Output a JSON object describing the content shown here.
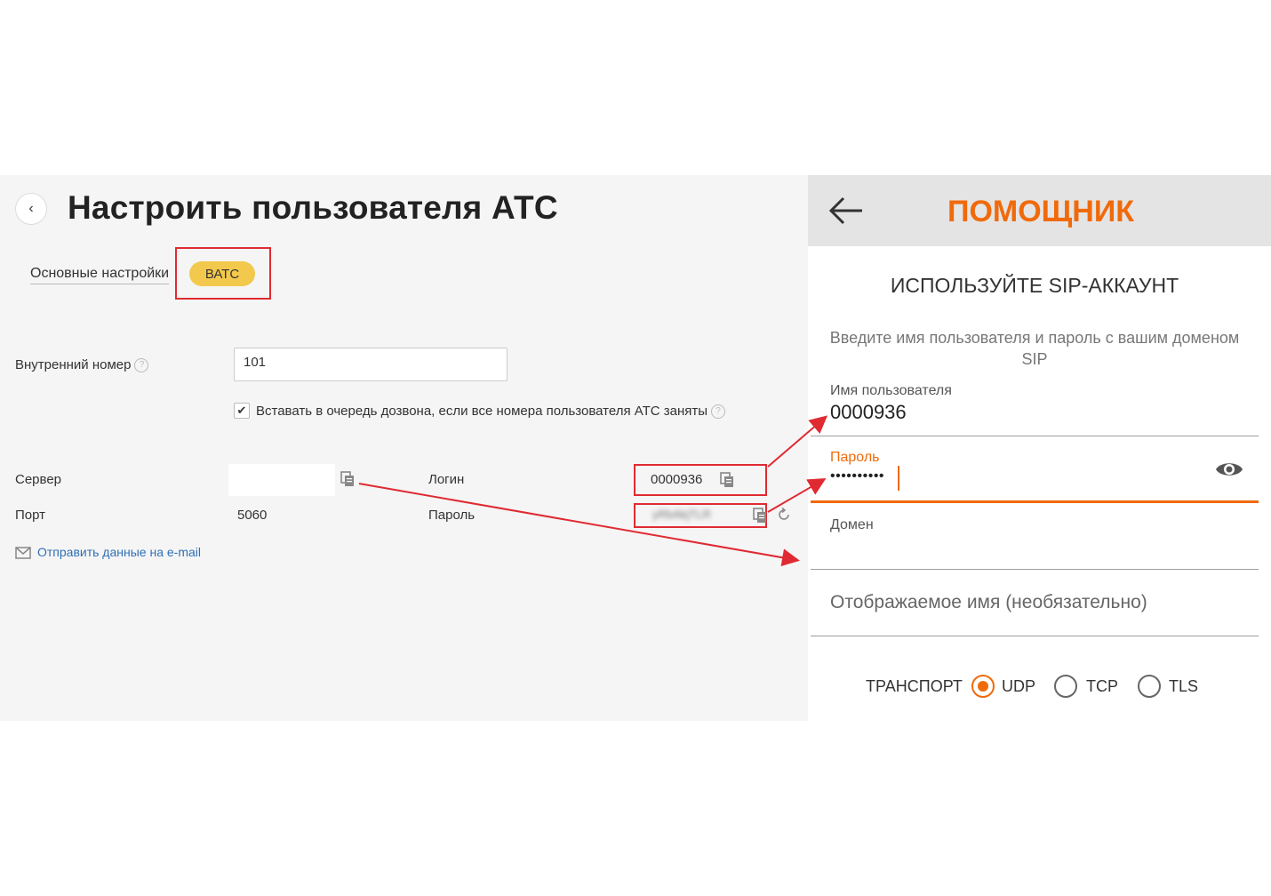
{
  "left": {
    "title": "Настроить пользователя АТС",
    "tabs": {
      "main": "Основные настройки",
      "vats": "ВАТС"
    },
    "extension": {
      "label": "Внутренний номер",
      "value": "101"
    },
    "queue_checkbox": {
      "label": "Вставать в очередь дозвона, если все номера пользователя АТС заняты",
      "checked": true
    },
    "server": {
      "label": "Сервер",
      "value": ""
    },
    "port": {
      "label": "Порт",
      "value": "5060"
    },
    "login": {
      "label": "Логин",
      "value": "0000936"
    },
    "password": {
      "label": "Пароль",
      "value": "yRbAkjTLR"
    },
    "email_link": "Отправить данные на e-mail"
  },
  "right": {
    "title": "ПОМОЩНИК",
    "heading": "ИСПОЛЬЗУЙТЕ SIP-АККАУНТ",
    "description": "Введите имя пользователя и пароль с вашим доменом SIP",
    "username": {
      "label": "Имя пользователя",
      "value": "0000936"
    },
    "password": {
      "label": "Пароль",
      "value": "••••••••••"
    },
    "domain": {
      "label": "Домен",
      "value": ""
    },
    "display_name": {
      "placeholder": "Отображаемое имя (необязательно)"
    },
    "transport": {
      "label": "ТРАНСПОРТ",
      "options": [
        "UDP",
        "TCP",
        "TLS"
      ],
      "selected": "UDP"
    }
  },
  "colors": {
    "accent": "#f06a0b",
    "highlight": "#e02a32",
    "badge": "#f2c94c",
    "link": "#2f6fb6"
  }
}
